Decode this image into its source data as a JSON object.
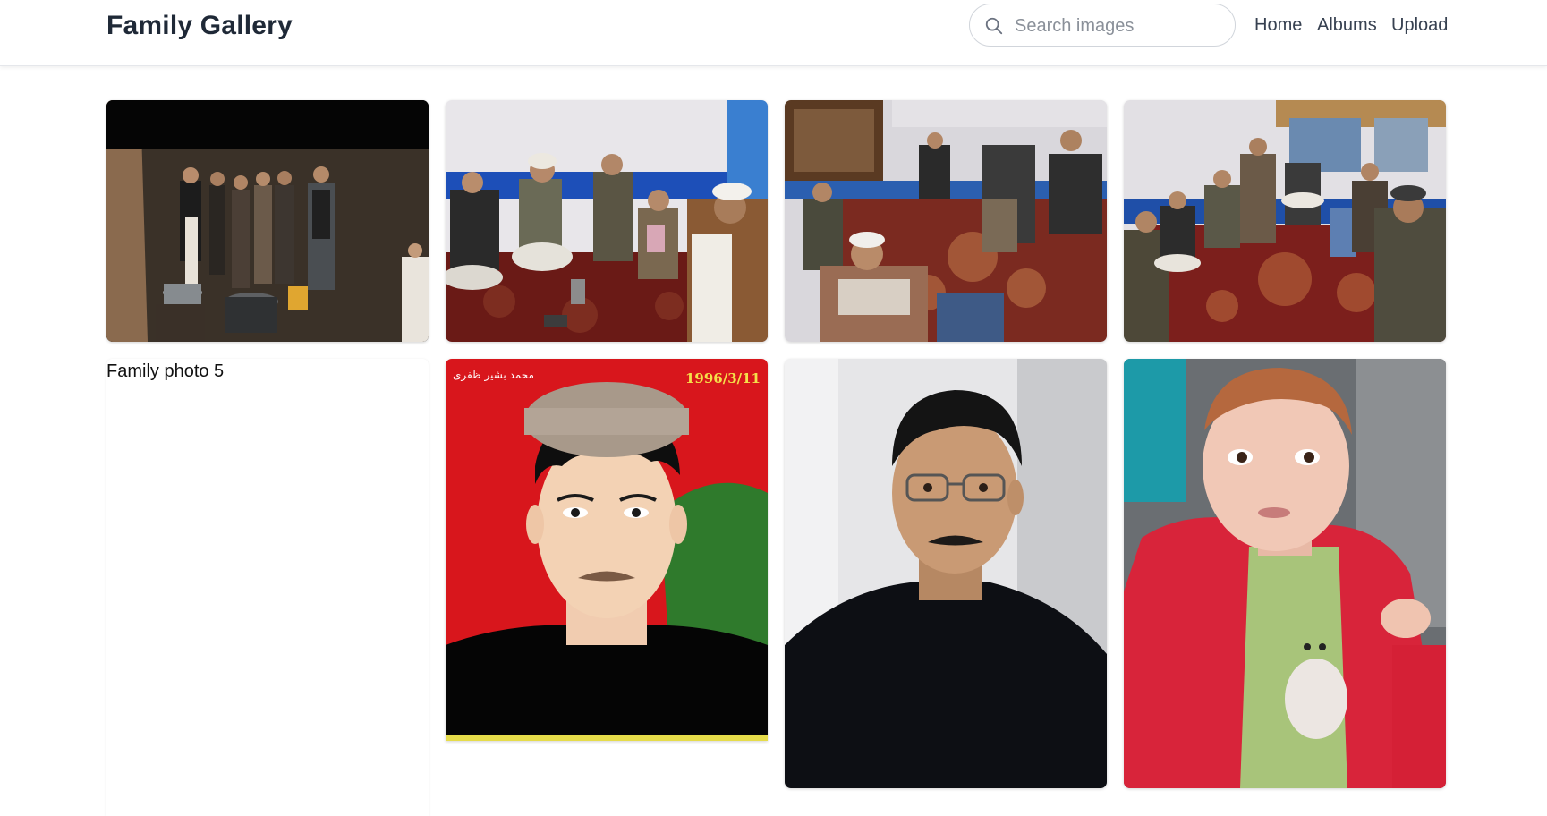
{
  "header": {
    "title": "Family Gallery",
    "search_placeholder": "Search images",
    "nav": [
      {
        "label": "Home"
      },
      {
        "label": "Albums"
      },
      {
        "label": "Upload"
      }
    ]
  },
  "gallery": {
    "broken_image_alt": "Family photo 5",
    "photo_4_date_stamp": "1996/3/11",
    "photo_4_arabic_caption": "محمد بشیر ظفری"
  },
  "colors": {
    "accent_text": "#1f2937",
    "nav_text": "#374151",
    "border": "#d1d5db"
  },
  "icons": {
    "search": "search-icon"
  }
}
